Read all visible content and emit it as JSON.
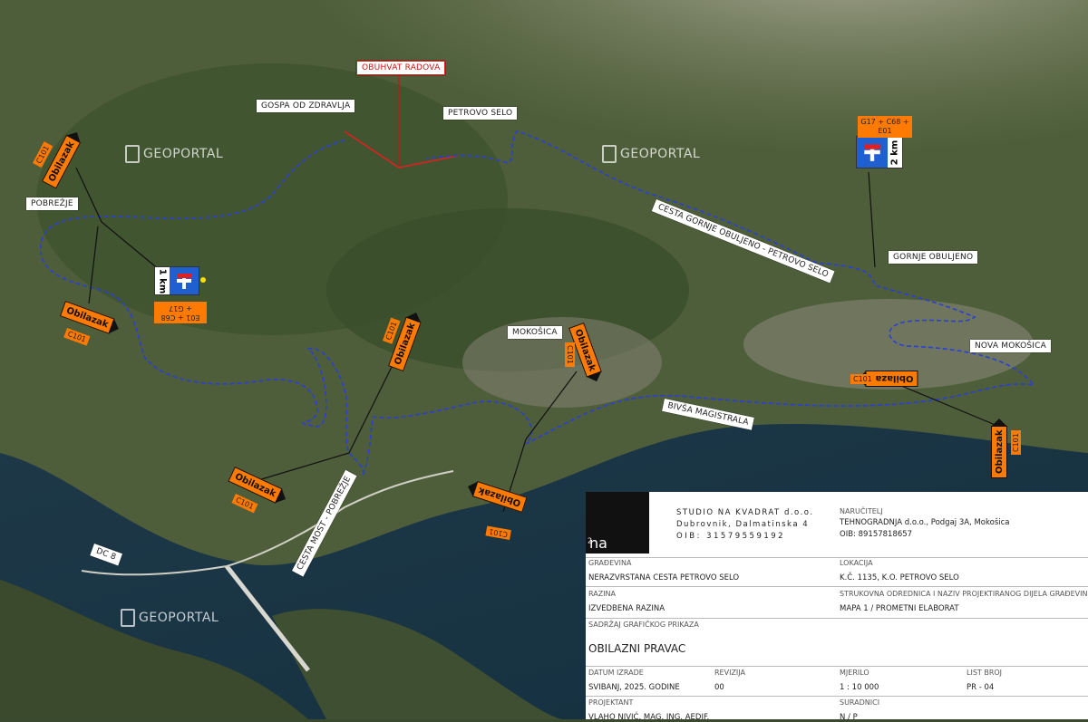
{
  "labels": {
    "obuhvat": "OBUHVAT RADOVA",
    "gospa": "GOSPA OD ZDRAVLJA",
    "petrovo": "PETROVO SELO",
    "pobrezje": "POBREŽJE",
    "cesta_gornje": "CESTA GORNJE OBULJENO - PETROVO SELO",
    "gornje_obuljeno": "GORNJE OBULJENO",
    "mokosica": "MOKOŠICA",
    "nova_mokosica": "NOVA MOKOŠICA",
    "bivsa": "BIVŠA MAGISTRALA",
    "cesta_most": "CESTA MOST - POBREŽJE",
    "dc8": "DC 8"
  },
  "watermark": "GEOPORTAL",
  "signs": {
    "obilazak": "Obilazak",
    "c101": "C101",
    "e01": "E01",
    "c68": "C68",
    "g17": "G17",
    "plus": "+",
    "km1": "1 km",
    "km2": "2 km"
  },
  "title_block": {
    "studio_name": "STUDIO NA KVADRAT d.o.o.",
    "studio_addr": "Dubrovnik, Dalmatinska 4",
    "studio_oib": "OIB: 31579559192",
    "logo_text": "na",
    "logo_sup": "2",
    "narucitelj_h": "NARUČITELJ",
    "narucitelj": "TEHNOGRADNJA d.o.o., Podgaj 3A, Mokošica",
    "narucitelj_oib": "OIB: 89157818657",
    "gradevina_h": "GRAĐEVINA",
    "gradevina": "NERAZVRSTANA CESTA PETROVO SELO",
    "lokacija_h": "LOKACIJA",
    "lokacija": "K.Č. 1135, K.O. PETROVO SELO",
    "razina_h": "RAZINA",
    "razina": "IZVEDBENA RAZINA",
    "strukovna_h": "STRUKOVNA ODREDNICA I NAZIV PROJEKTIRANOG DIJELA GRAĐEVINE",
    "strukovna": "MAPA 1 / PROMETNI ELABORAT",
    "sadrzaj_h": "SADRŽAJ GRAFIČKOG PRIKAZA",
    "sadrzaj": "OBILAZNI PRAVAC",
    "datum_h": "DATUM IZRADE",
    "datum": "SVIBANJ, 2025. GODINE",
    "revizija_h": "REVIZIJA",
    "revizija": "00",
    "mjerilo_h": "MJERILO",
    "mjerilo": "1 : 10 000",
    "list_h": "LIST BROJ",
    "list": "PR - 04",
    "projektant_h": "PROJEKTANT",
    "projektant": "VLAHO NIVIĆ, MAG. ING. AEDIF.",
    "suradnici_h": "SURADNICI",
    "suradnici": "N / P"
  },
  "colors": {
    "route": "#2a3fd6",
    "works": "#e02020",
    "sign": "#ff7a00",
    "dead_end": "#1f5fd0"
  }
}
